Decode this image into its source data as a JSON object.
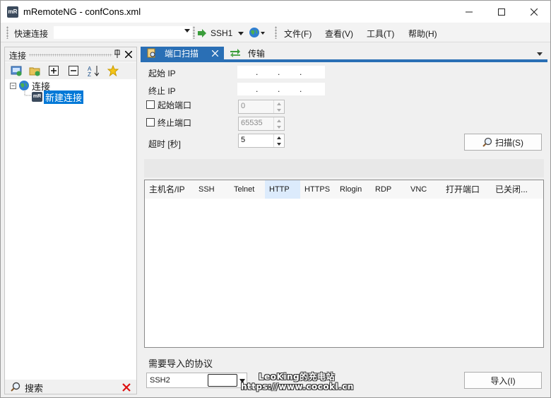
{
  "window": {
    "title": "mRemoteNG - confCons.xml",
    "app_icon_text": "mR"
  },
  "toolbar": {
    "quick_connect_label": "快速连接",
    "quick_connect_value": "",
    "protocol_button": "SSH1"
  },
  "menu": [
    "文件(F)",
    "查看(V)",
    "工具(T)",
    "帮助(H)"
  ],
  "connections_panel": {
    "title": "连接",
    "tree": {
      "root": "连接",
      "child": "新建连接"
    },
    "search_label": "搜索"
  },
  "tabs": [
    {
      "label": "端口扫描",
      "active": true
    },
    {
      "label": "传输",
      "active": false
    }
  ],
  "scan": {
    "start_ip_label": "起始 IP",
    "end_ip_label": "终止 IP",
    "start_port_label": "起始端口",
    "end_port_label": "终止端口",
    "timeout_label": "超时 [秒]",
    "start_port_value": "0",
    "end_port_value": "65535",
    "timeout_value": "5",
    "scan_button": "扫描(S)"
  },
  "results": {
    "columns": [
      "主机名/IP",
      "SSH",
      "Telnet",
      "HTTP",
      "HTTPS",
      "Rlogin",
      "RDP",
      "VNC",
      "打开端口",
      "已关闭..."
    ],
    "rows": []
  },
  "import": {
    "label": "需要导入的协议",
    "protocol_value": "SSH2",
    "button": "导入(I)"
  },
  "watermark": {
    "line1": "LeoKing的充电站",
    "line2": "https://www.cocokl.cn"
  },
  "colors": {
    "accent": "#2a6fb5",
    "selection": "#0078d7",
    "header_highlight": "#dcebfc"
  }
}
